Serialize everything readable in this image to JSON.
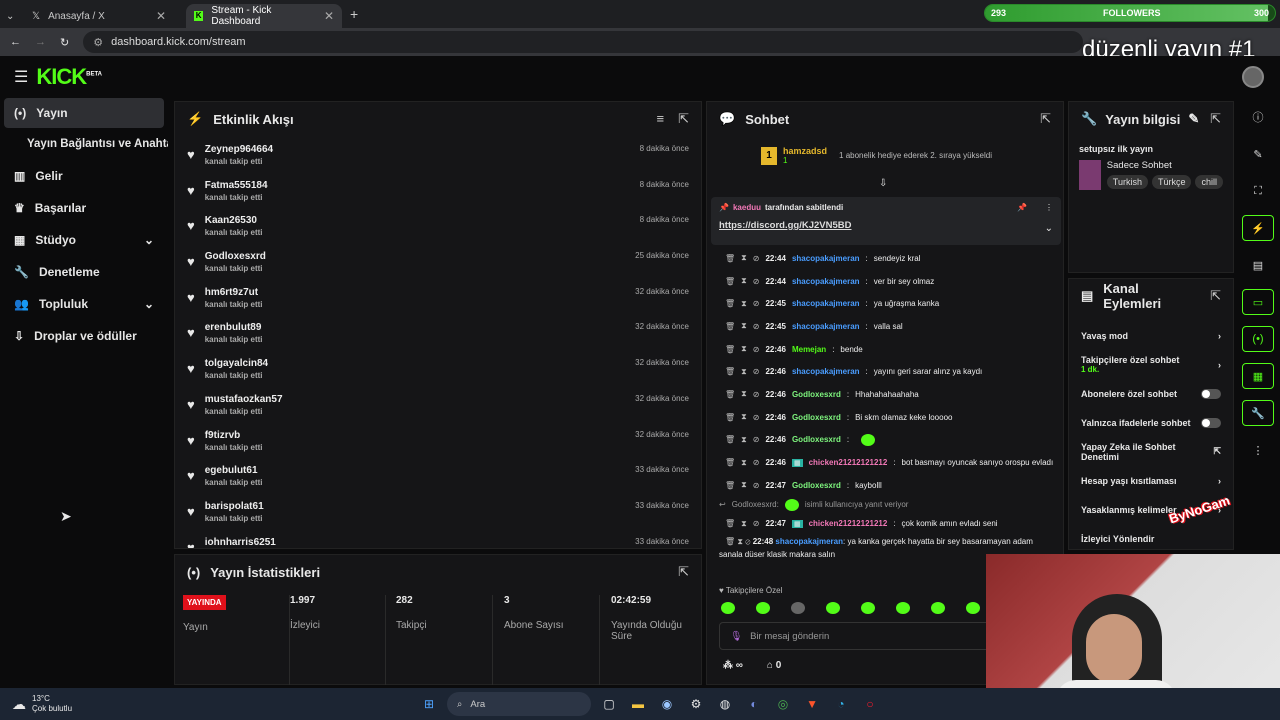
{
  "browser": {
    "tabs": [
      {
        "label": "Anasayfa / X"
      },
      {
        "label": "Stream - Kick Dashboard"
      }
    ],
    "url": "dashboard.kick.com/stream"
  },
  "overlay": {
    "followers_start": "293",
    "followers_label": "FOLLOWERS",
    "followers_goal": "300",
    "followers_progress": 0.977,
    "stream_title": "düzenli yayın #1",
    "brand": "ByNoGam"
  },
  "header": {
    "logo": "KICK",
    "logo_badge": "BETA"
  },
  "sidebar": {
    "items": [
      {
        "label": "Yayın",
        "icon": "broadcast-icon"
      },
      {
        "label": "Yayın Bağlantısı ve Anahtarı",
        "icon": ""
      },
      {
        "label": "Gelir",
        "icon": "chart-icon"
      },
      {
        "label": "Başarılar",
        "icon": "trophy-icon"
      },
      {
        "label": "Stüdyo",
        "icon": "studio-icon"
      },
      {
        "label": "Denetleme",
        "icon": "wrench-icon"
      },
      {
        "label": "Topluluk",
        "icon": "community-icon"
      },
      {
        "label": "Droplar ve ödüller",
        "icon": "drops-icon"
      }
    ]
  },
  "activity": {
    "title": "Etkinlik Akışı",
    "events": [
      {
        "user": "Zeynep964664",
        "action": "kanalı takip etti",
        "time": "8 dakika önce"
      },
      {
        "user": "Fatma555184",
        "action": "kanalı takip etti",
        "time": "8 dakika önce"
      },
      {
        "user": "Kaan26530",
        "action": "kanalı takip etti",
        "time": "8 dakika önce"
      },
      {
        "user": "Godloxesxrd",
        "action": "kanalı takip etti",
        "time": "25 dakika önce"
      },
      {
        "user": "hm6rt9z7ut",
        "action": "kanalı takip etti",
        "time": "32 dakika önce"
      },
      {
        "user": "erenbulut89",
        "action": "kanalı takip etti",
        "time": "32 dakika önce"
      },
      {
        "user": "tolgayalcin84",
        "action": "kanalı takip etti",
        "time": "32 dakika önce"
      },
      {
        "user": "mustafaozkan57",
        "action": "kanalı takip etti",
        "time": "32 dakika önce"
      },
      {
        "user": "f9tizrvb",
        "action": "kanalı takip etti",
        "time": "32 dakika önce"
      },
      {
        "user": "egebulut61",
        "action": "kanalı takip etti",
        "time": "33 dakika önce"
      },
      {
        "user": "barispolat61",
        "action": "kanalı takip etti",
        "time": "33 dakika önce"
      },
      {
        "user": "iohnharris6251",
        "action": "",
        "time": "33 dakika önce"
      }
    ]
  },
  "stats": {
    "title": "Yayın İstatistikleri",
    "live_badge": "YAYINDA",
    "live_label": "Yayın",
    "items": [
      {
        "value": "1.997",
        "label": "İzleyici"
      },
      {
        "value": "282",
        "label": "Takipçi"
      },
      {
        "value": "3",
        "label": "Abone Sayısı"
      },
      {
        "value": "02:42:59",
        "label": "Yayında Olduğu Süre"
      }
    ]
  },
  "chat": {
    "title": "Sohbet",
    "gift": {
      "rank": "1",
      "user": "hamzadsd",
      "count": "1",
      "text": "1 abonelik hediye ederek 2. sıraya yükseldi"
    },
    "pinned": {
      "by": "kaeduu",
      "label": "tarafından sabitlendi",
      "link": "https://discord.gg/KJ2VN5BD"
    },
    "messages": [
      {
        "time": "22:44",
        "user": "shacopakajmeran",
        "color": "blue",
        "text": "sendeyiz kral"
      },
      {
        "time": "22:44",
        "user": "shacopakajmeran",
        "color": "blue",
        "text": "ver bir sey olmaz"
      },
      {
        "time": "22:45",
        "user": "shacopakajmeran",
        "color": "blue",
        "text": "ya uğraşma kanka"
      },
      {
        "time": "22:45",
        "user": "shacopakajmeran",
        "color": "blue",
        "text": "valla sal"
      },
      {
        "time": "22:46",
        "user": "Memejan",
        "color": "green",
        "text": "bende"
      },
      {
        "time": "22:46",
        "user": "shacopakajmeran",
        "color": "blue",
        "text": "yayını geri sarar alınz ya kaydı"
      },
      {
        "time": "22:46",
        "user": "Godloxesxrd",
        "color": "green2",
        "text": "Hhahahahaahaha"
      },
      {
        "time": "22:46",
        "user": "Godloxesxrd",
        "color": "green2",
        "text": "Bi skm olamaz keke looooo"
      },
      {
        "time": "22:46",
        "user": "Godloxesxrd",
        "color": "green2",
        "text": ""
      },
      {
        "time": "22:46",
        "user": "chicken21212121212",
        "color": "pink",
        "text": "bot basmayı oyuncak sanıyo orospu evladı"
      },
      {
        "time": "22:47",
        "user": "Godloxesxrd",
        "color": "green2",
        "text": "kaybolll"
      },
      {
        "time": "22:47",
        "user": "chicken21212121212",
        "color": "pink",
        "text": "çok komik amın evladı seni",
        "reply": "Godloxesxrd:",
        "reply_note": "isimli kullanıcıya yanıt veriyor"
      },
      {
        "time": "22:48",
        "user": "shacopakajmeran",
        "color": "blue",
        "text": "ya kanka gerçek hayatta bir sey basaramayan adam sanala düser klasik makara salın"
      }
    ],
    "followers_only": "Takipçilere Özel",
    "input_placeholder": "Bir mesaj gönderin",
    "footer_count": "0"
  },
  "stream_info": {
    "title": "Yayın bilgisi",
    "stream_title": "setupsız ilk yayın",
    "category": "Sadece Sohbet",
    "tags": [
      "Turkish",
      "Türkçe",
      "chill"
    ]
  },
  "channel_actions": {
    "title": "Kanal Eylemleri",
    "items": [
      {
        "label": "Yavaş mod",
        "control": "chevron"
      },
      {
        "label": "Takipçilere özel sohbet",
        "sub": "1 dk.",
        "control": "chevron"
      },
      {
        "label": "Abonelere özel sohbet",
        "control": "toggle"
      },
      {
        "label": "Yalnızca ifadelerle sohbet",
        "control": "toggle"
      },
      {
        "label": "Yapay Zeka ile Sohbet Denetimi",
        "control": "external"
      },
      {
        "label": "Hesap yaşı kısıtlaması",
        "control": "chevron"
      },
      {
        "label": "Yasaklanmış kelimeler",
        "control": "chevron"
      },
      {
        "label": "İzleyici Yönlendir",
        "control": "none"
      }
    ]
  },
  "taskbar": {
    "weather_temp": "13°C",
    "weather_text": "Çok bulutlu",
    "search": "Ara"
  },
  "colors": {
    "kick_green": "#53fc18",
    "live_red": "#e0111b"
  }
}
